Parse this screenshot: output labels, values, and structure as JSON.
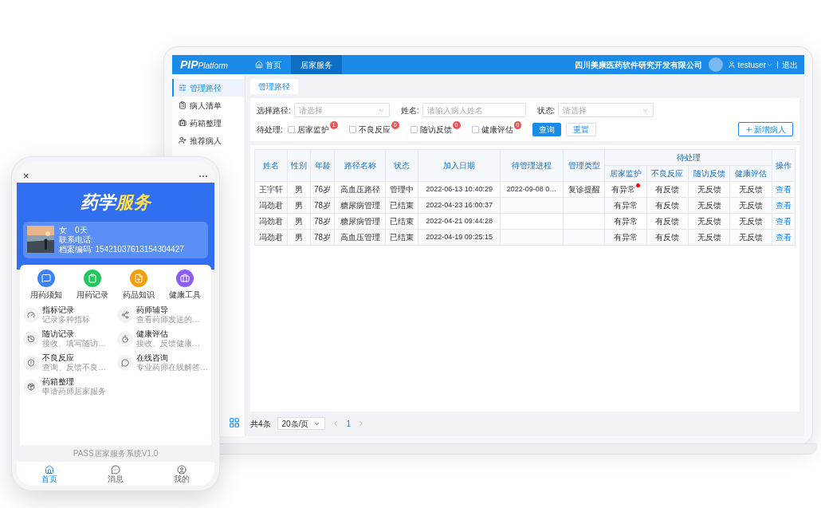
{
  "laptop": {
    "logo": "PIP",
    "logo_suffix": "Platform",
    "nav": [
      {
        "label": "首页",
        "selected": false
      },
      {
        "label": "居家服务",
        "selected": true
      }
    ],
    "company": "四川美康医药软件研究开发有限公司",
    "user": "testuser",
    "logout": "退出",
    "sidebar": [
      {
        "label": "管理路径",
        "selected": true
      },
      {
        "label": "病人清单",
        "selected": false
      },
      {
        "label": "药箱整理",
        "selected": false
      },
      {
        "label": "推荐病人",
        "selected": false
      }
    ],
    "tab": "管理路径",
    "filters": {
      "path_label": "选择路径:",
      "path_placeholder": "请选择",
      "name_label": "姓名:",
      "name_placeholder": "请输入病人姓名",
      "status_label": "状态:",
      "status_placeholder": "请选择"
    },
    "pending_label": "待处理:",
    "pending": [
      {
        "label": "居家监护",
        "count": "1",
        "checked": false
      },
      {
        "label": "不良反应",
        "count": "0",
        "checked": false
      },
      {
        "label": "随访反馈",
        "count": "0",
        "checked": false
      },
      {
        "label": "健康评估",
        "count": "0",
        "checked": false
      }
    ],
    "query": "查询",
    "reset": "重置",
    "add": "新增病人",
    "table": {
      "columns": [
        "姓名",
        "性别",
        "年龄",
        "路径名称",
        "状态",
        "加入日期",
        "待管理进程",
        "管理类型"
      ],
      "group": "待处理",
      "sub_columns": [
        "居家监护",
        "不良反应",
        "随访反馈",
        "健康评估"
      ],
      "action_column": "操作",
      "rows": [
        {
          "cells": [
            "王宇轩",
            "男",
            "76岁",
            "高血压路径",
            "管理中",
            "2022-06-13 10:40:29",
            "2022-09-08 0…",
            "复诊提醒"
          ],
          "pending": [
            "有异常",
            "有反馈",
            "无反馈",
            "无反馈"
          ],
          "alert": true,
          "action": "查看"
        },
        {
          "cells": [
            "冯劲君",
            "男",
            "78岁",
            "糖尿病管理",
            "已结束",
            "2022-04-23 16:00:37",
            "",
            ""
          ],
          "pending": [
            "有异常",
            "有反馈",
            "无反馈",
            "无反馈"
          ],
          "alert": false,
          "action": "查看"
        },
        {
          "cells": [
            "冯劲君",
            "男",
            "78岁",
            "糖尿病管理",
            "已结束",
            "2022-04-21 09:44:28",
            "",
            ""
          ],
          "pending": [
            "有异常",
            "有反馈",
            "无反馈",
            "无反馈"
          ],
          "alert": false,
          "action": "查看"
        },
        {
          "cells": [
            "冯劲君",
            "男",
            "78岁",
            "高血压管理",
            "已结束",
            "2022-04-19 09:25:15",
            "",
            ""
          ],
          "pending": [
            "有异常",
            "有反馈",
            "无反馈",
            "无反馈"
          ],
          "alert": false,
          "action": "查看"
        }
      ]
    },
    "footer": {
      "total": "共4条",
      "page_size": "20条/页",
      "page": "1"
    }
  },
  "phone": {
    "close": "×",
    "more": "⋯",
    "banner": {
      "title": "药学",
      "title_highlight": "服务"
    },
    "profile": {
      "gender": "女",
      "days": "0天",
      "phone_label": "联系电话:",
      "record_label": "档案编码:",
      "record": "15421037613154304427"
    },
    "grid": [
      {
        "label": "用药须知",
        "color": "#3b82f6"
      },
      {
        "label": "用药记录",
        "color": "#22c55e"
      },
      {
        "label": "药品知识",
        "color": "#f59e0b"
      },
      {
        "label": "健康工具",
        "color": "#8b5cf6"
      }
    ],
    "items": [
      {
        "title": "指标记录",
        "desc": "记录多种指标"
      },
      {
        "title": "药师辅导",
        "desc": "查看药师发送的…"
      },
      {
        "title": "随访记录",
        "desc": "接收、填写随访…"
      },
      {
        "title": "健康评估",
        "desc": "接收、反馈健康…"
      },
      {
        "title": "不良反应",
        "desc": "查询、反馈不良…"
      },
      {
        "title": "在线咨询",
        "desc": "专业药师在线解答…"
      },
      {
        "title": "药箱整理",
        "desc": "申请药师居家服务"
      }
    ],
    "version": "PASS居家服务系统V1.0",
    "tabs": [
      {
        "label": "首页",
        "selected": true
      },
      {
        "label": "消息",
        "selected": false
      },
      {
        "label": "我的",
        "selected": false
      }
    ]
  }
}
